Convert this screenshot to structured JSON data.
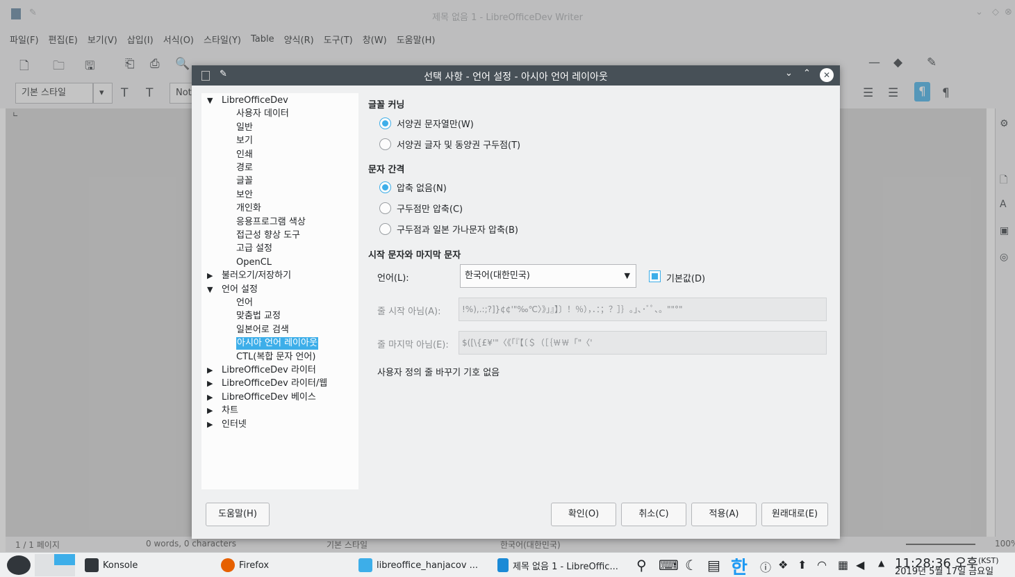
{
  "window": {
    "title": "제목 없음 1 - LibreOfficeDev Writer"
  },
  "menubar": [
    "파일(F)",
    "편집(E)",
    "보기(V)",
    "삽입(I)",
    "서식(O)",
    "스타일(Y)",
    "Table",
    "양식(R)",
    "도구(T)",
    "창(W)",
    "도움말(H)"
  ],
  "toolbar": {
    "paragraph_style": "기본 스타일",
    "font_name_partial": "Not"
  },
  "dialog": {
    "title": "선택 사항 - 언어 설정 - 아시아 언어 레이아웃",
    "tree": [
      {
        "label": "LibreOfficeDev",
        "level": 0,
        "expanded": true
      },
      {
        "label": "사용자 데이터",
        "level": 1
      },
      {
        "label": "일반",
        "level": 1
      },
      {
        "label": "보기",
        "level": 1
      },
      {
        "label": "인쇄",
        "level": 1
      },
      {
        "label": "경로",
        "level": 1
      },
      {
        "label": "글꼴",
        "level": 1
      },
      {
        "label": "보안",
        "level": 1
      },
      {
        "label": "개인화",
        "level": 1
      },
      {
        "label": "응용프로그램 색상",
        "level": 1
      },
      {
        "label": "접근성 향상 도구",
        "level": 1
      },
      {
        "label": "고급 설정",
        "level": 1
      },
      {
        "label": "OpenCL",
        "level": 1
      },
      {
        "label": "불러오기/저장하기",
        "level": 0,
        "expanded": false
      },
      {
        "label": "언어 설정",
        "level": 0,
        "expanded": true
      },
      {
        "label": "언어",
        "level": 1
      },
      {
        "label": "맞춤법 교정",
        "level": 1
      },
      {
        "label": "일본어로 검색",
        "level": 1
      },
      {
        "label": "아시아 언어 레이아웃",
        "level": 1,
        "selected": true
      },
      {
        "label": "CTL(복합 문자 언어)",
        "level": 1
      },
      {
        "label": "LibreOfficeDev 라이터",
        "level": 0,
        "expanded": false
      },
      {
        "label": "LibreOfficeDev 라이터/웹",
        "level": 0,
        "expanded": false
      },
      {
        "label": "LibreOfficeDev 베이스",
        "level": 0,
        "expanded": false
      },
      {
        "label": "차트",
        "level": 0,
        "expanded": false
      },
      {
        "label": "인터넷",
        "level": 0,
        "expanded": false
      }
    ],
    "kerning": {
      "heading": "글꼴 커닝",
      "opt1": "서양권 문자열만(W)",
      "opt2": "서양권 글자 및 동양권 구두점(T)",
      "selected": 1
    },
    "spacing": {
      "heading": "문자 간격",
      "opt1": "압축 없음(N)",
      "opt2": "구두점만 압축(C)",
      "opt3": "구두점과 일본 가나문자 압축(B)",
      "selected": 1
    },
    "firstlast": {
      "heading": "시작 문자와 마지막 문자",
      "language_label": "언어(L):",
      "language_value": "한국어(대한민국)",
      "default_label": "기본값(D)",
      "default_checked": true,
      "not_start_label": "줄 시작 아님(A):",
      "not_start_value": "!%),.:;?]}¢¢'\"‰℃〉》」』】〕！％），．：；？］｝｡｣､･ﾞﾟ、。\"\"°\"",
      "not_end_label": "줄 마지막 아님(E):",
      "not_end_value": "$([\\{£¥'\"〈《「『【〔＄（［｛￦￦「\"〈'",
      "note": "사용자 정의 줄 바꾸기 기호 없음"
    },
    "buttons": {
      "help": "도움말(H)",
      "ok": "확인(O)",
      "cancel": "취소(C)",
      "apply": "적용(A)",
      "reset": "원래대로(E)"
    }
  },
  "statusbar": {
    "page": "1 / 1 페이지",
    "words": "0 words, 0 characters",
    "style": "기본 스타일",
    "language": "한국어(대한민국)",
    "zoom": "100%"
  },
  "taskbar": {
    "tasks": [
      "Konsole",
      "Firefox",
      "libreoffice_hanjacov ...",
      "제목 없음 1 - LibreOffic..."
    ],
    "ime": "한",
    "time": "11:28:36 오후",
    "tz": "(KST)",
    "date": "2019년 5월 17일 금요일"
  }
}
